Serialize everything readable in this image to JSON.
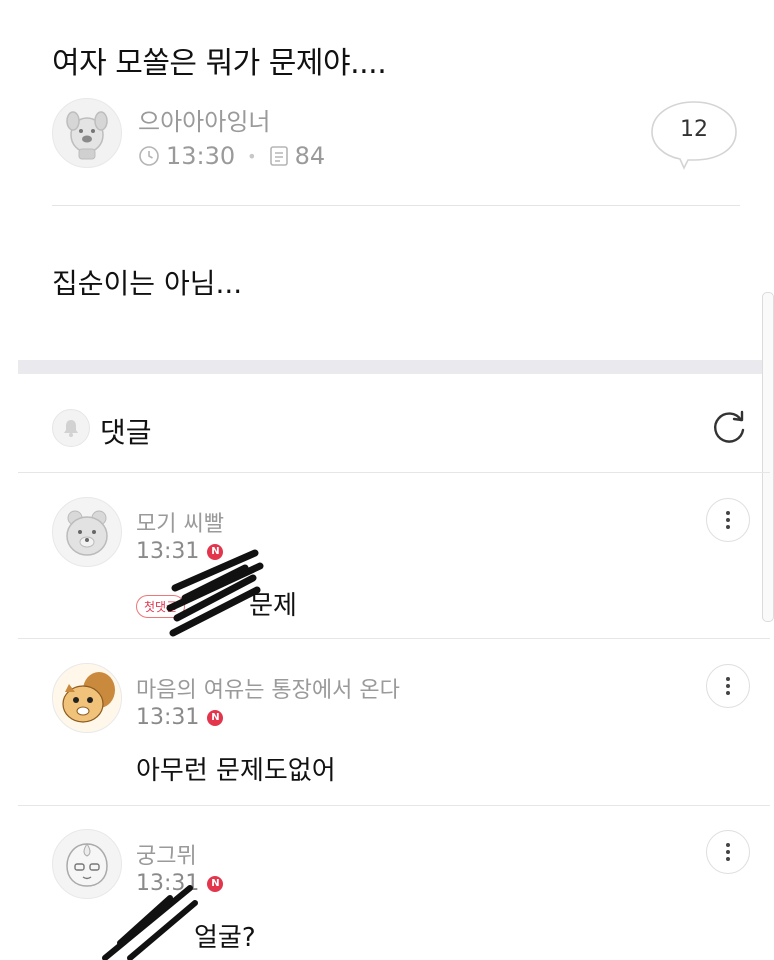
{
  "post": {
    "title": "여자 모쏠은 뭐가 문제야....",
    "author": "으아아아잉너",
    "time": "13:30",
    "views": "84",
    "comment_count": "12",
    "body": "집순이는 아님..."
  },
  "comments_section": {
    "title": "댓글"
  },
  "comments": [
    {
      "author": "모기 씨빨",
      "time": "13:31",
      "badge": "N",
      "first_label": "첫댓글",
      "text": "문제"
    },
    {
      "author": "마음의 여유는 통장에서 온다",
      "time": "13:31",
      "badge": "N",
      "text": "아무런 문제도없어"
    },
    {
      "author": "궁그뮈",
      "time": "13:31",
      "badge": "N",
      "text": "얼굴?"
    }
  ],
  "icons": {
    "time": "clock-icon",
    "views": "document-icon",
    "comments_header": "bell-icon",
    "refresh": "refresh-icon",
    "more": "more-vertical-icon"
  },
  "colors": {
    "accent_red": "#e3364d",
    "muted_text": "#9a9a9a"
  }
}
